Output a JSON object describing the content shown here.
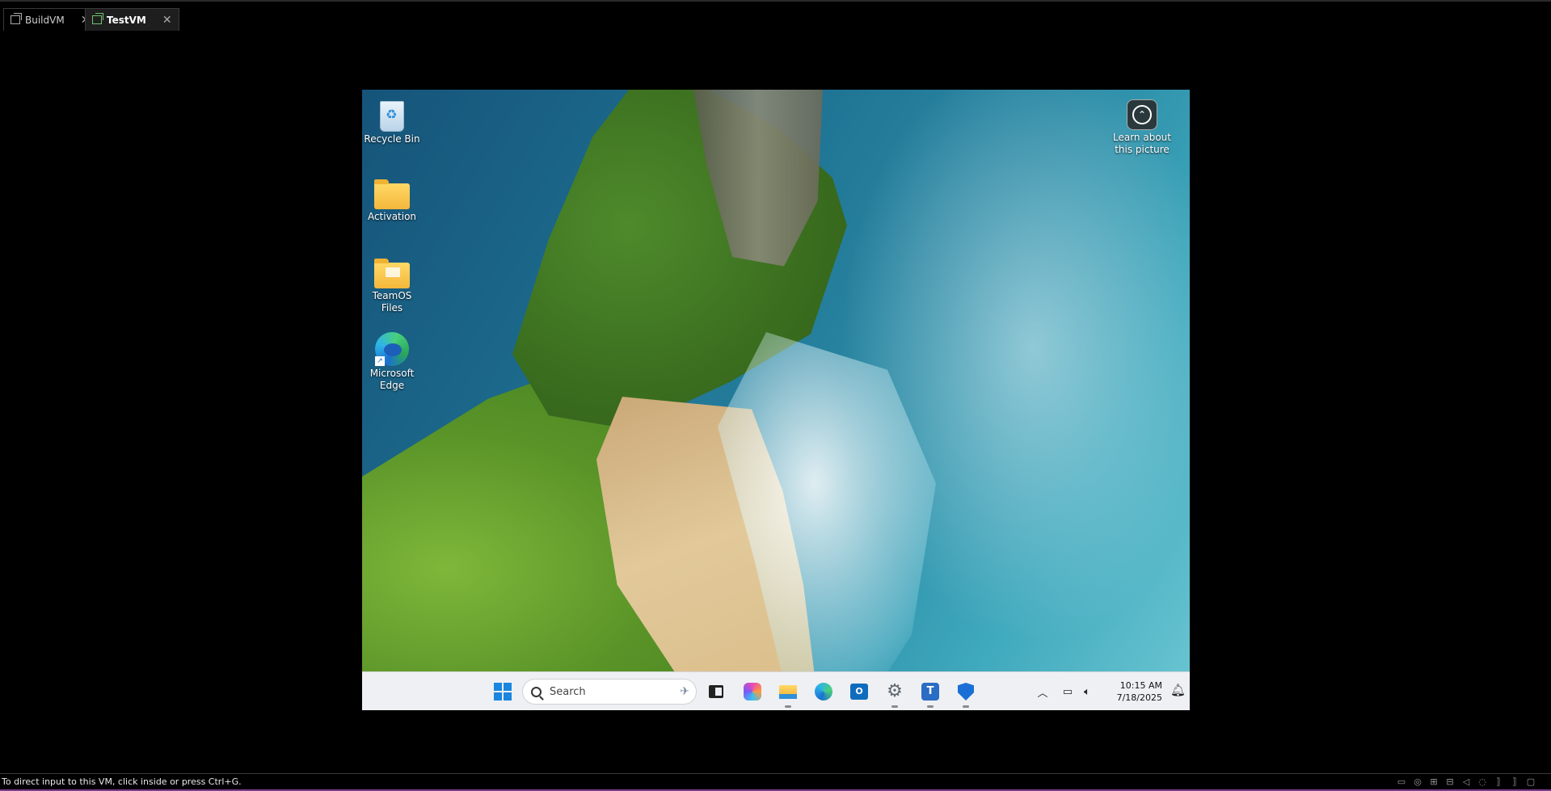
{
  "host": {
    "tabs": [
      {
        "label": "BuildVM",
        "active": false
      },
      {
        "label": "TestVM",
        "active": true
      }
    ],
    "status_text": "To direct input to this VM, click inside or press Ctrl+G.",
    "status_icons": [
      "hard-disk-icon",
      "cd-icon",
      "network-icon",
      "usb-icon",
      "sound-icon",
      "printer-icon",
      "bracket-icon",
      "bracket-icon",
      "message-icon"
    ]
  },
  "desktop": {
    "icons": [
      {
        "label": "Recycle Bin",
        "icon": "recycle-bin-icon"
      },
      {
        "label": "Activation",
        "icon": "folder-icon"
      },
      {
        "label": "TeamOS Files",
        "icon": "folder-icon"
      },
      {
        "label": "Microsoft Edge",
        "icon": "edge-icon"
      }
    ],
    "learn_about": "Learn about this picture"
  },
  "taskbar": {
    "search_placeholder": "Search",
    "pinned": [
      "start-icon",
      "task-view-icon",
      "copilot-icon",
      "file-explorer-icon",
      "edge-icon",
      "outlook-icon",
      "settings-icon",
      "teams-icon",
      "defender-icon"
    ],
    "time": "10:15 AM",
    "date": "7/18/2025",
    "colors": {
      "accent": "#1a86e0",
      "taskbar_bg": "#eef0f3"
    }
  }
}
